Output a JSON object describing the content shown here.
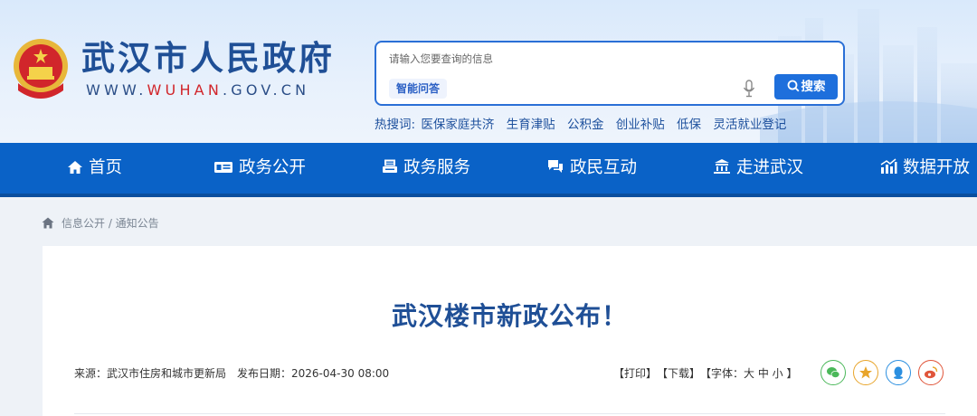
{
  "header": {
    "title": "武汉市人民政府",
    "url_prefix": "WWW.",
    "url_highlight": "WUHAN",
    "url_suffix": ".GOV.CN",
    "search_placeholder": "请输入您要查询的信息",
    "ai_tag": "智能问答",
    "search_button": "搜索",
    "hot_label": "热搜词:",
    "hot_terms": [
      "医保家庭共济",
      "生育津贴",
      "公积金",
      "创业补贴",
      "低保",
      "灵活就业登记"
    ]
  },
  "nav": {
    "items": [
      {
        "label": "首页",
        "icon": "home-icon"
      },
      {
        "label": "政务公开",
        "icon": "id-card-icon"
      },
      {
        "label": "政务服务",
        "icon": "printer-icon"
      },
      {
        "label": "政民互动",
        "icon": "chat-icon"
      },
      {
        "label": "走进武汉",
        "icon": "building-icon"
      },
      {
        "label": "数据开放",
        "icon": "chart-icon"
      }
    ]
  },
  "breadcrumb": "信息公开 / 通知公告",
  "article": {
    "title": "武汉楼市新政公布！",
    "source": "来源：武汉市住房和城市更新局",
    "date": "发布日期：2026-04-30 08:00",
    "print": "【打印】",
    "download": "【下载】",
    "font_size": "【字体：大 中 小 】"
  },
  "share": {
    "icons": [
      "wechat-icon",
      "favorite-icon",
      "qq-icon",
      "weibo-icon"
    ],
    "colors": [
      "#4bb85a",
      "#e8a52b",
      "#2b8fe0",
      "#e0553a"
    ]
  },
  "colors": {
    "brand_blue": "#1f4f96",
    "nav_blue": "#0a62c7",
    "accent_red": "#d1262b"
  }
}
